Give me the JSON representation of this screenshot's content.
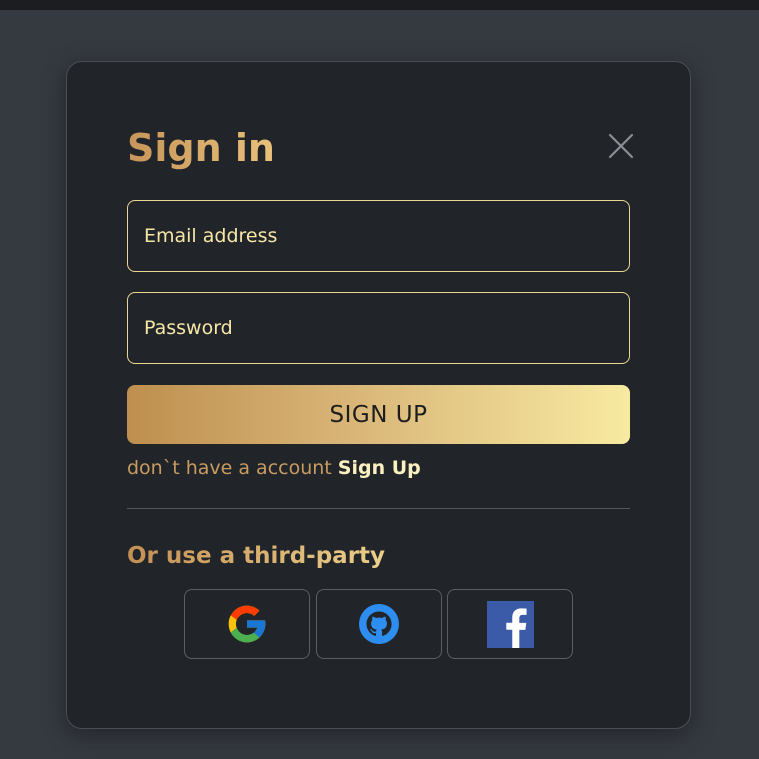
{
  "dialog": {
    "title": "Sign in",
    "close_icon": "close-icon"
  },
  "form": {
    "email": {
      "placeholder": "Email address",
      "value": ""
    },
    "password": {
      "placeholder": "Password",
      "value": ""
    },
    "submit_label": "SIGN UP"
  },
  "account": {
    "prompt": "don`t have a account ",
    "link_label": "Sign Up"
  },
  "third_party": {
    "heading": "Or use a third-party",
    "providers": [
      {
        "name": "google",
        "icon": "google-icon"
      },
      {
        "name": "github",
        "icon": "github-icon"
      },
      {
        "name": "facebook",
        "icon": "facebook-icon"
      }
    ]
  },
  "colors": {
    "background": "#353940",
    "modal": "#212429",
    "gold_start": "#be8f4e",
    "gold_end": "#f8eaa1",
    "field_border": "#e9d98e",
    "field_text": "#f5e7a6"
  }
}
